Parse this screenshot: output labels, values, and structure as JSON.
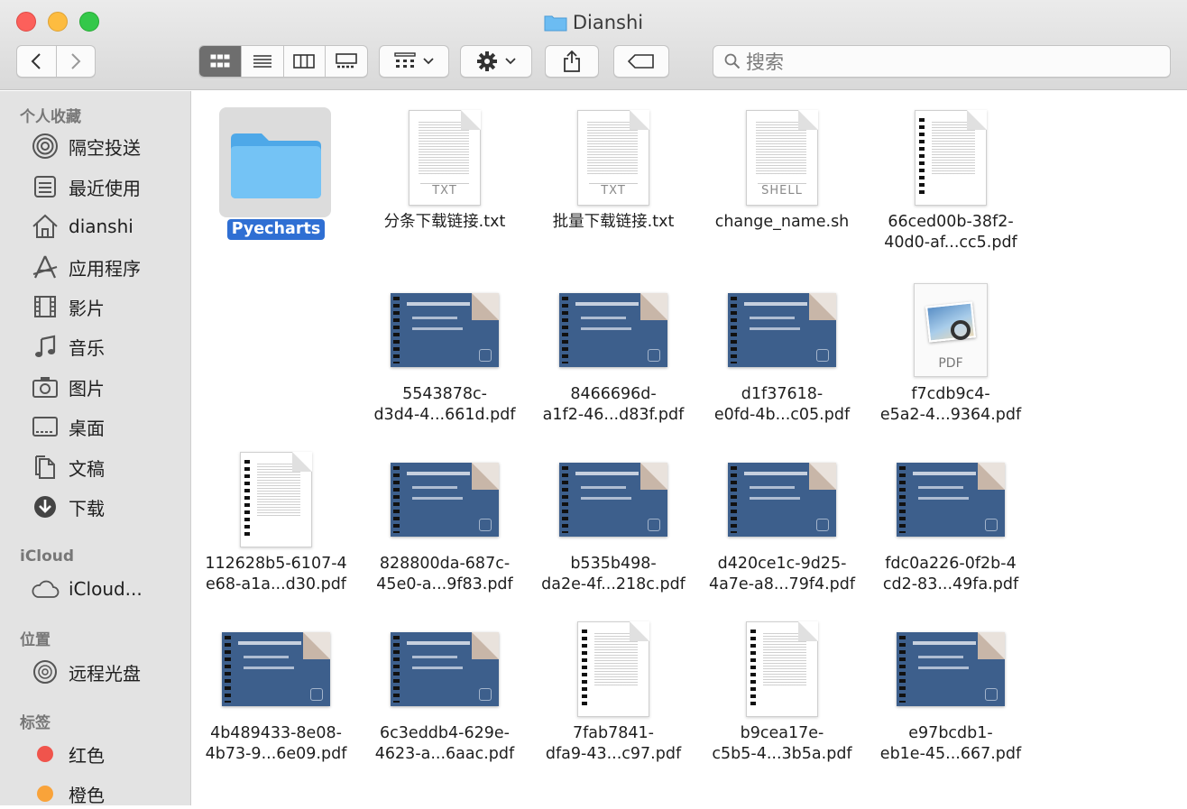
{
  "window": {
    "title": "Dianshi",
    "search_placeholder": "搜索"
  },
  "colors": {
    "accent": "#2f6fd3",
    "folder": "#5eb6f0",
    "sidebar_bg": "#e3e3e3"
  },
  "sidebar": {
    "favorites_heading": "个人收藏",
    "favorites": [
      {
        "label": "隔空投送",
        "icon": "airdrop-icon"
      },
      {
        "label": "最近使用",
        "icon": "recents-icon"
      },
      {
        "label": "dianshi",
        "icon": "home-icon"
      },
      {
        "label": "应用程序",
        "icon": "applications-icon"
      },
      {
        "label": "影片",
        "icon": "movies-icon"
      },
      {
        "label": "音乐",
        "icon": "music-icon"
      },
      {
        "label": "图片",
        "icon": "pictures-icon"
      },
      {
        "label": "桌面",
        "icon": "desktop-icon"
      },
      {
        "label": "文稿",
        "icon": "documents-icon"
      },
      {
        "label": "下载",
        "icon": "downloads-icon"
      }
    ],
    "icloud_heading": "iCloud",
    "icloud_items": [
      {
        "label": "iCloud...",
        "icon": "icloud-icon"
      }
    ],
    "locations_heading": "位置",
    "locations": [
      {
        "label": "远程光盘",
        "icon": "remote-disc-icon"
      }
    ],
    "tags_heading": "标签",
    "tags": [
      {
        "label": "红色",
        "color": "#f0544c"
      },
      {
        "label": "橙色",
        "color": "#f9a33a"
      }
    ]
  },
  "files": [
    {
      "line1": "Pyecharts",
      "line2": "",
      "kind": "folder",
      "selected": true
    },
    {
      "line1": "分条下载链接.txt",
      "line2": "",
      "kind": "txt",
      "ext": "TXT"
    },
    {
      "line1": "批量下载链接.txt",
      "line2": "",
      "kind": "txt",
      "ext": "TXT"
    },
    {
      "line1": "change_name.sh",
      "line2": "",
      "kind": "txt",
      "ext": "SHELL"
    },
    {
      "line1": "66ced00b-38f2-",
      "line2": "40d0-af...cc5.pdf",
      "kind": "pdfdoc"
    },
    {
      "line1": "5543878c-",
      "line2": "d3d4-4...661d.pdf",
      "kind": "slide"
    },
    {
      "line1": "8466696d-",
      "line2": "a1f2-46...d83f.pdf",
      "kind": "slide"
    },
    {
      "line1": "d1f37618-",
      "line2": "e0fd-4b...c05.pdf",
      "kind": "slide"
    },
    {
      "line1": "f7cdb9c4-",
      "line2": "e5a2-4...9364.pdf",
      "kind": "pdficon",
      "ext": "PDF"
    },
    {
      "line1": "112628b5-6107-4",
      "line2": "e68-a1a...d30.pdf",
      "kind": "pdfdoc"
    },
    {
      "line1": "828800da-687c-",
      "line2": "45e0-a...9f83.pdf",
      "kind": "slide"
    },
    {
      "line1": "b535b498-",
      "line2": "da2e-4f...218c.pdf",
      "kind": "slide"
    },
    {
      "line1": "d420ce1c-9d25-",
      "line2": "4a7e-a8...79f4.pdf",
      "kind": "slide"
    },
    {
      "line1": "fdc0a226-0f2b-4",
      "line2": "cd2-83...49fa.pdf",
      "kind": "slide"
    },
    {
      "line1": "4b489433-8e08-",
      "line2": "4b73-9...6e09.pdf",
      "kind": "slide"
    },
    {
      "line1": "6c3eddb4-629e-",
      "line2": "4623-a...6aac.pdf",
      "kind": "slide"
    },
    {
      "line1": "7fab7841-",
      "line2": "dfa9-43...c97.pdf",
      "kind": "pdfdoc"
    },
    {
      "line1": "b9cea17e-",
      "line2": "c5b5-4...3b5a.pdf",
      "kind": "pdfdoc"
    },
    {
      "line1": "e97bcdb1-",
      "line2": "eb1e-45...667.pdf",
      "kind": "slide"
    }
  ]
}
